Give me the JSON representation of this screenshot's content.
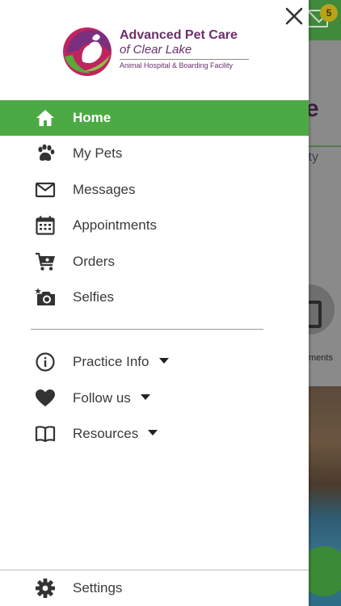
{
  "background": {
    "badge_count": "5",
    "title_fragment": "e",
    "subtitle_fragment": "ity",
    "tile_label_fragment": "ments"
  },
  "drawer": {
    "logo": {
      "name": "Advanced Pet Care",
      "subname": "of Clear Lake",
      "tagline": "Animal Hospital & Boarding Facility"
    },
    "primary_items": [
      {
        "label": "Home",
        "icon": "home-icon",
        "active": true
      },
      {
        "label": "My Pets",
        "icon": "paw-icon"
      },
      {
        "label": "Messages",
        "icon": "envelope-icon"
      },
      {
        "label": "Appointments",
        "icon": "calendar-icon"
      },
      {
        "label": "Orders",
        "icon": "cart-icon"
      },
      {
        "label": "Selfies",
        "icon": "camera-icon"
      }
    ],
    "secondary_items": [
      {
        "label": "Practice Info",
        "icon": "info-icon"
      },
      {
        "label": "Follow us",
        "icon": "heart-icon"
      },
      {
        "label": "Resources",
        "icon": "book-icon"
      }
    ],
    "settings_label": "Settings"
  },
  "colors": {
    "accent_green": "#4caa44",
    "brand_purple": "#6a2f6b"
  }
}
